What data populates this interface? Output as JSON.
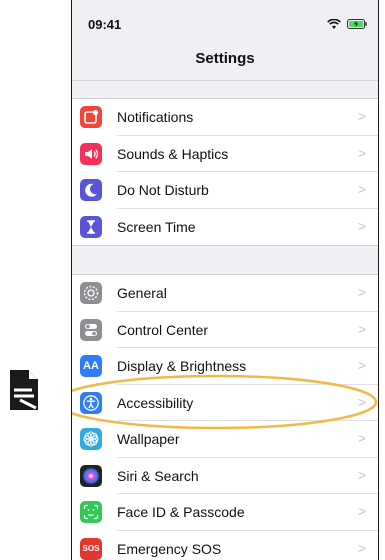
{
  "status_bar": {
    "time": "09:41",
    "wifi_icon": "wifi-icon",
    "battery_icon": "battery-charging-icon"
  },
  "nav": {
    "title": "Settings"
  },
  "colors": {
    "notifications": "#f2443a",
    "sounds": "#f23258",
    "dnd": "#5a55d6",
    "screen_time": "#5a55d6",
    "general": "#8e8e93",
    "control_center": "#8e8e93",
    "display": "#2f7df6",
    "accessibility": "#2f7df6",
    "wallpaper": "#31aadf",
    "siri": "#222222",
    "face_id": "#34c759",
    "sos": "#e0382f",
    "highlight": "#f0b94a"
  },
  "groups": [
    {
      "items": [
        {
          "name": "notifications",
          "label": "Notifications",
          "icon": "notifications-icon"
        },
        {
          "name": "sounds-haptics",
          "label": "Sounds & Haptics",
          "icon": "speaker-icon"
        },
        {
          "name": "do-not-disturb",
          "label": "Do Not Disturb",
          "icon": "moon-icon"
        },
        {
          "name": "screen-time",
          "label": "Screen Time",
          "icon": "hourglass-icon"
        }
      ]
    },
    {
      "items": [
        {
          "name": "general",
          "label": "General",
          "icon": "gear-icon"
        },
        {
          "name": "control-center",
          "label": "Control Center",
          "icon": "toggles-icon"
        },
        {
          "name": "display-brightness",
          "label": "Display & Brightness",
          "icon": "text-size-icon",
          "icon_text": "AA"
        },
        {
          "name": "accessibility",
          "label": "Accessibility",
          "icon": "accessibility-icon",
          "highlighted": true
        },
        {
          "name": "wallpaper",
          "label": "Wallpaper",
          "icon": "flower-icon"
        },
        {
          "name": "siri-search",
          "label": "Siri & Search",
          "icon": "siri-icon"
        },
        {
          "name": "face-id-passcode",
          "label": "Face ID & Passcode",
          "icon": "face-id-icon"
        },
        {
          "name": "emergency-sos",
          "label": "Emergency SOS",
          "icon": "sos-icon",
          "icon_text": "SOS"
        }
      ]
    }
  ],
  "chevron": ">"
}
